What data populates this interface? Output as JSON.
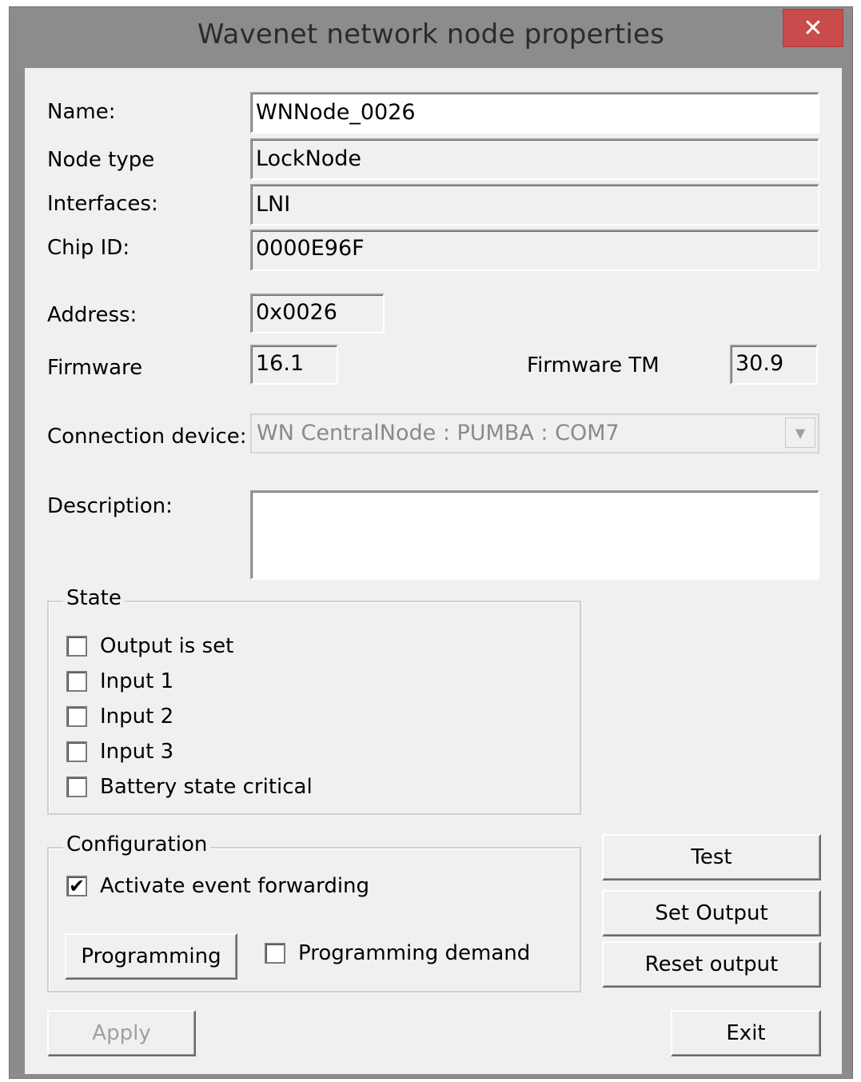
{
  "window": {
    "title": "Wavenet network node properties",
    "close_glyph": "✕"
  },
  "form": {
    "name_label": "Name:",
    "name_value": "WNNode_0026",
    "node_type_label": "Node type",
    "node_type_value": "LockNode",
    "interfaces_label": "Interfaces:",
    "interfaces_value": "LNI",
    "chip_id_label": "Chip ID:",
    "chip_id_value": "0000E96F",
    "address_label": "Address:",
    "address_value": "0x0026",
    "firmware_label": "Firmware",
    "firmware_value": "16.1",
    "firmware_tm_label": "Firmware TM",
    "firmware_tm_value": "30.9",
    "connection_device_label": "Connection device:",
    "connection_device_value": "WN CentralNode : PUMBA : COM7",
    "description_label": "Description:",
    "description_value": ""
  },
  "state": {
    "title": "State",
    "items": [
      {
        "label": "Output is set",
        "checked": false
      },
      {
        "label": "Input 1",
        "checked": false
      },
      {
        "label": "Input 2",
        "checked": false
      },
      {
        "label": "Input 3",
        "checked": false
      },
      {
        "label": "Battery state critical",
        "checked": false
      }
    ]
  },
  "configuration": {
    "title": "Configuration",
    "event_forwarding_label": "Activate event forwarding",
    "event_forwarding_checked": true,
    "programming_button": "Programming",
    "programming_demand_label": "Programming demand",
    "programming_demand_checked": false
  },
  "buttons": {
    "test": "Test",
    "set_output": "Set Output",
    "reset_output": "Reset output",
    "apply": "Apply",
    "exit": "Exit"
  },
  "colors": {
    "frame": "#8c8c8c",
    "client_bg": "#f0f0f0",
    "close_button": "#c94b4b"
  },
  "icons": {
    "close": "close-icon",
    "dropdown": "chevron-down-icon",
    "check": "checkmark-icon"
  }
}
